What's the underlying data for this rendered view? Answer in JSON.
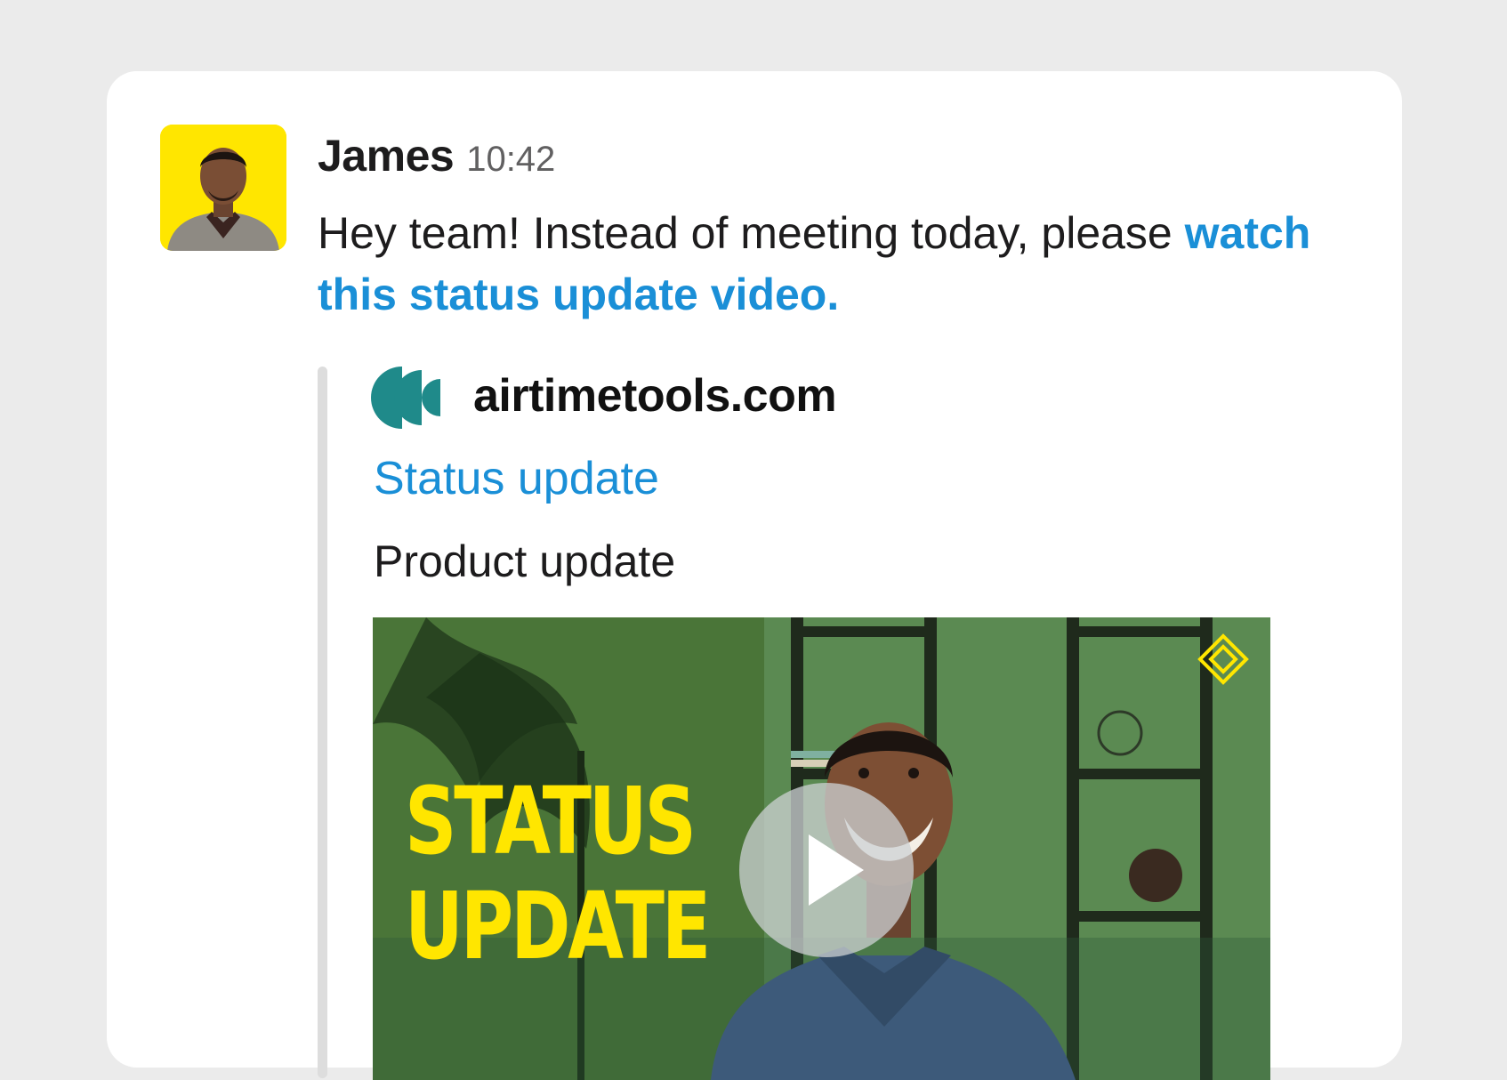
{
  "message": {
    "author": "James",
    "time": "10:42",
    "text": "Hey team! Instead of meeting today, please ",
    "link_text": "watch this status update video."
  },
  "attachment": {
    "site": "airtimetools.com",
    "title": "Status update",
    "description": "Product update",
    "video_overlay_line1": "STATUS",
    "video_overlay_line2": "UPDATE"
  },
  "colors": {
    "link": "#1a8fd7",
    "avatar_bg": "#ffe600",
    "site_icon": "#1f8a8a",
    "overlay_text": "#ffe600"
  }
}
